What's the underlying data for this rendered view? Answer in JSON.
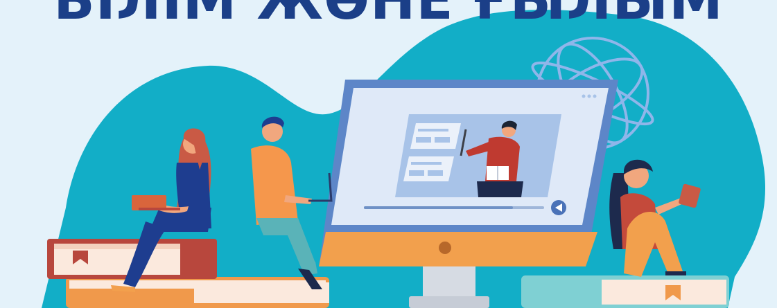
{
  "headline": "БІЛІМ ЖӘНЕ ҒЫЛЫМ",
  "colors": {
    "background": "#e4f2fa",
    "blob": "#12aec7",
    "headline": "#1b3f88",
    "monitor_frame": "#f2a04d",
    "monitor_bezel": "#5d86c8",
    "screen": "#dfe9f8",
    "book_red": "#b8473d",
    "book_orange": "#f0994b",
    "book_teal": "#7fd0d3",
    "book_pages": "#fbe9dd",
    "globe": "#8fb6ea"
  },
  "icons": {
    "globe": "globe-icon",
    "monitor": "monitor-icon",
    "play": "play-back-icon",
    "menu_dots": "more-dots-icon",
    "bookmark": "bookmark-icon"
  }
}
